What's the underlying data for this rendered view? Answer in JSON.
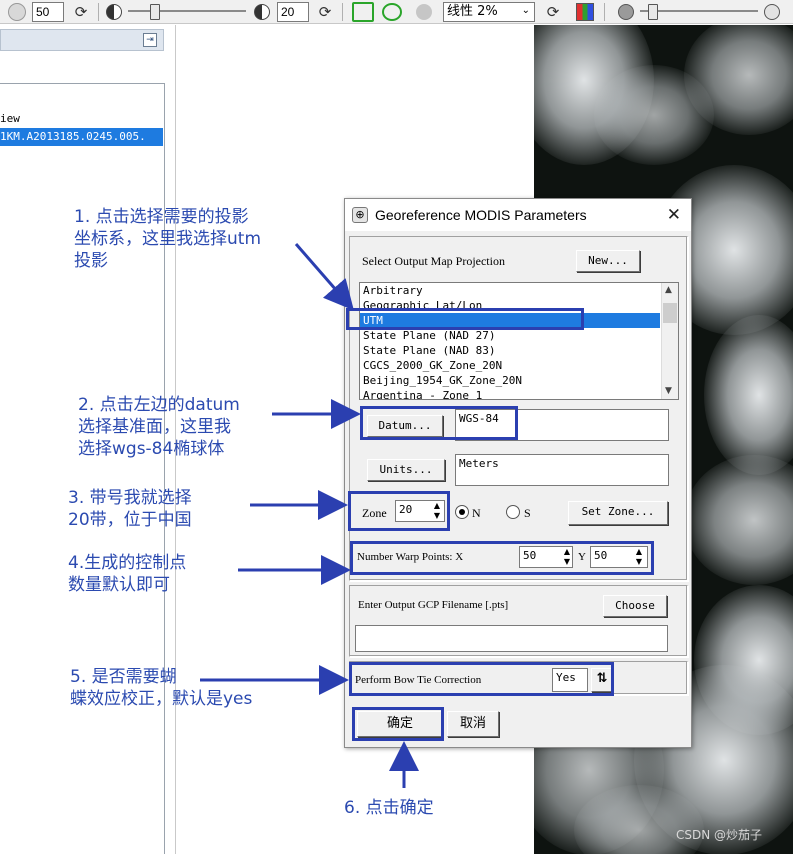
{
  "toolbar": {
    "brightness_value": "50",
    "contrast_value": "20",
    "stretch_select": "线性 2%"
  },
  "left_panel": {
    "view_label": "iew",
    "file_label": "1KM.A2013185.0245.005."
  },
  "dialog": {
    "title": "Georeference MODIS Parameters",
    "projection_label": "Select Output Map Projection",
    "new_button": "New...",
    "projection_items": [
      "Arbitrary",
      "Geographic Lat/Lon",
      "UTM",
      "State Plane (NAD 27)",
      "State Plane (NAD 83)",
      "CGCS_2000_GK_Zone_20N",
      "Beijing_1954_GK_Zone_20N",
      "Argentina - Zone 1"
    ],
    "selected_projection": "UTM",
    "datum_button": "Datum...",
    "datum_value": "WGS-84",
    "units_button": "Units...",
    "units_value": "Meters",
    "zone_label": "Zone",
    "zone_value": "20",
    "north_label": "N",
    "south_label": "S",
    "hemisphere": "N",
    "set_zone_button": "Set Zone...",
    "warp_label": "Number Warp Points: X",
    "warp_x": "50",
    "warp_y_label": "Y",
    "warp_y": "50",
    "gcp_label": "Enter Output GCP Filename [.pts]",
    "choose_button": "Choose",
    "gcp_filename": "",
    "bowtie_label": "Perform Bow Tie Correction",
    "bowtie_value": "Yes",
    "ok_button": "确定",
    "cancel_button": "取消"
  },
  "annotations": {
    "step1": [
      "1. 点击选择需要的投影",
      "坐标系，这里我选择utm",
      "投影"
    ],
    "step2": [
      "2. 点击左边的datum",
      "选择基准面，这里我",
      "选择wgs-84椭球体"
    ],
    "step3": [
      "3. 带号我就选择",
      "20带，位于中国"
    ],
    "step4": [
      "4.生成的控制点",
      "数量默认即可"
    ],
    "step5": [
      "5. 是否需要蝴",
      "蝶效应校正，默认是yes"
    ],
    "step6": [
      "6. 点击确定"
    ]
  },
  "watermark": "CSDN @炒茄子",
  "colors": {
    "annotation": "#2b4ab0",
    "selection": "#1e7be0"
  }
}
